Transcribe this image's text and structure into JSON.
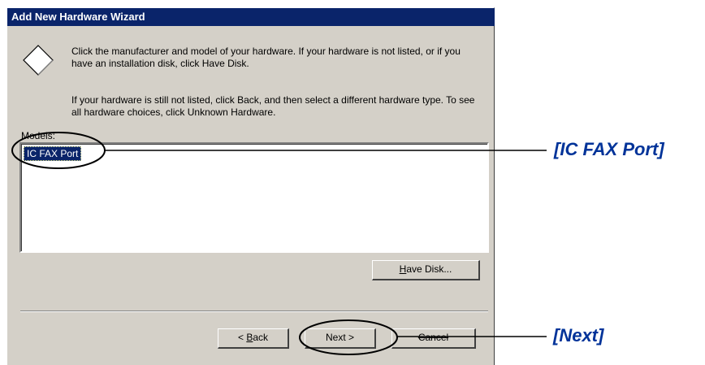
{
  "window": {
    "title": "Add New Hardware Wizard"
  },
  "instructions": {
    "line1": "Click the manufacturer and model of your hardware. If your hardware is not listed, or if you have an installation disk, click Have Disk.",
    "line2": "If your hardware is still not listed, click Back, and then select a different hardware type. To see all hardware choices, click Unknown Hardware."
  },
  "models": {
    "label": "Models:",
    "items": [
      "IC FAX Port"
    ],
    "selected": "IC FAX Port"
  },
  "buttons": {
    "have_disk": {
      "mnemonic": "H",
      "rest": "ave Disk..."
    },
    "back": {
      "prefix": "< ",
      "mnemonic": "B",
      "rest": "ack"
    },
    "next": "Next >",
    "cancel": "Cancel"
  },
  "callouts": {
    "model": "[IC FAX Port]",
    "next": "[Next]"
  },
  "colors": {
    "title_bar": "#0a246a",
    "dialog_face": "#d4d0c8",
    "selection": "#0a246a",
    "callout_text": "#003399"
  },
  "icons": {
    "wizard": "diamond-hardware-icon"
  }
}
